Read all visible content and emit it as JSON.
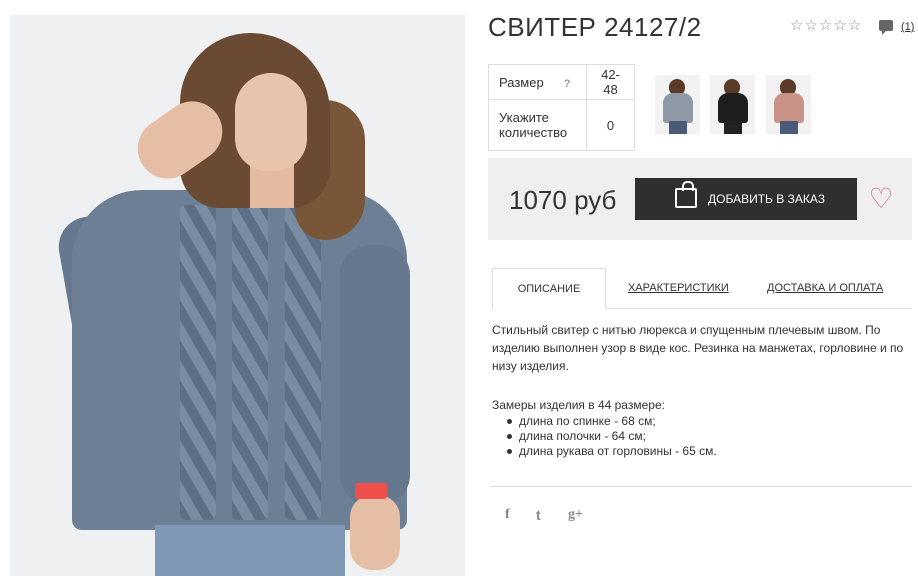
{
  "product": {
    "title": "СВИТЕР 24127/2",
    "rating_stars": "☆☆☆☆☆",
    "review_count": "(1)"
  },
  "options": {
    "size_label": "Размер",
    "size_help": "?",
    "size_value": "42-48",
    "qty_label_line1": "Укажите",
    "qty_label_line2": "количество",
    "qty_value": "0"
  },
  "thumbnails": [
    {
      "color_name": "gray",
      "color": "#8f98a6"
    },
    {
      "color_name": "black",
      "color": "#1e1e1e"
    },
    {
      "color_name": "pink",
      "color": "#c99387"
    }
  ],
  "purchase": {
    "price": "1070 руб",
    "add_label": "ДОБАВИТЬ В ЗАКАЗ",
    "heart": "♡"
  },
  "tabs": [
    {
      "label": "ОПИСАНИЕ"
    },
    {
      "label": "ХАРАКТЕРИСТИКИ"
    },
    {
      "label": "ДОСТАВКА И ОПЛАТА"
    }
  ],
  "description": {
    "text": "Стильный свитер с нитью люрекса и спущенным плечевым швом. По изделию выполнен узор в виде кос. Резинка на манжетах, горловине и по низу изделия.",
    "measurements_title": "Замеры изделия в 44 размере:",
    "measurements": [
      "длина по спинке - 68 см;",
      "длина полочки - 64 см;",
      "длина рукава от горловины - 65 см."
    ]
  },
  "social": {
    "facebook": "f",
    "twitter": "t",
    "google": "g+"
  }
}
